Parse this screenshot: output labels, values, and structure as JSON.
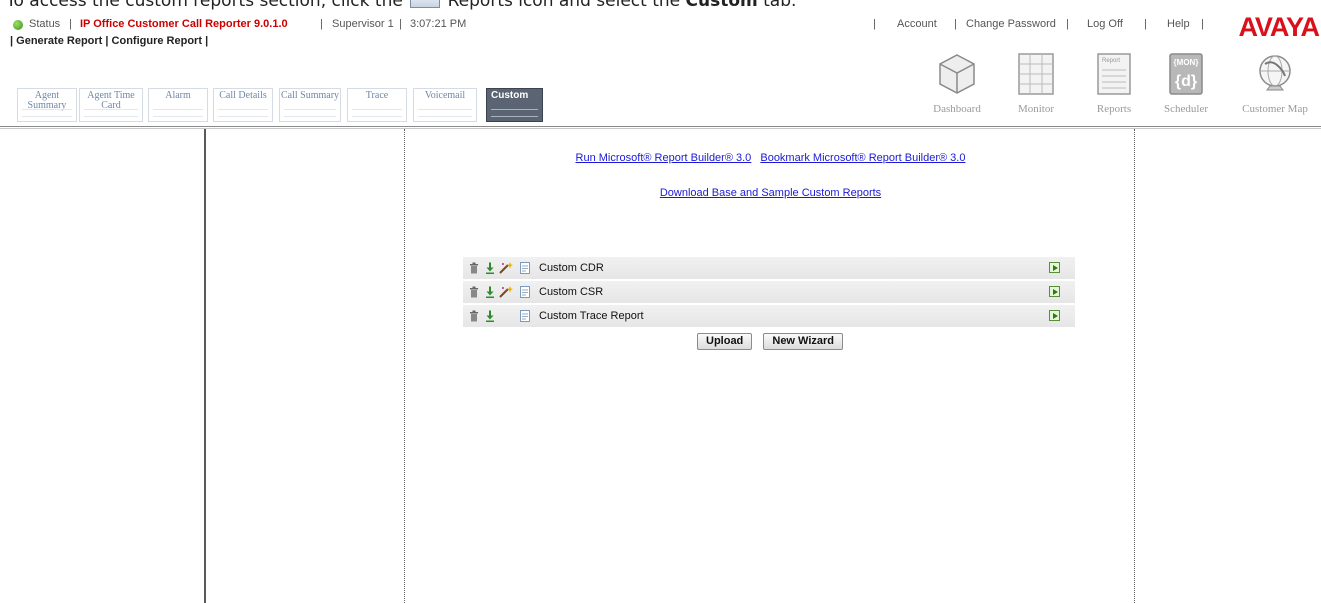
{
  "caption": {
    "before": "To access the custom reports section, click the",
    "middle": "Reports icon and select the",
    "bold": "Custom",
    "after": "tab."
  },
  "status_bar": {
    "status_label": "Status",
    "sep": "|",
    "product": "IP Office Customer Call Reporter 9.0.1.0",
    "user": "Supervisor 1",
    "time": "3:07:21 PM",
    "links": [
      "Account",
      "Change Password",
      "Log Off",
      "Help"
    ],
    "logo": "AVAYA"
  },
  "sub_nav": {
    "generate": "Generate Report",
    "configure": "Configure Report"
  },
  "report_tabs": [
    {
      "label": "Agent Summary"
    },
    {
      "label": "Agent Time Card"
    },
    {
      "label": "Alarm"
    },
    {
      "label": "Call Details"
    },
    {
      "label": "Call Summary"
    },
    {
      "label": "Trace"
    },
    {
      "label": "Voicemail"
    },
    {
      "label": "Custom"
    }
  ],
  "top_icons": [
    {
      "label": "Dashboard",
      "icon": "dashboard-icon"
    },
    {
      "label": "Monitor",
      "icon": "monitor-icon"
    },
    {
      "label": "Reports",
      "icon": "reports-icon",
      "badge": "Report"
    },
    {
      "label": "Scheduler",
      "icon": "scheduler-icon",
      "badge": "{MON}"
    },
    {
      "label": "Customer Map",
      "icon": "globe-icon"
    }
  ],
  "content": {
    "run_builder": "Run Microsoft® Report Builder® 3.0",
    "bookmark_builder": "Bookmark Microsoft® Report Builder® 3.0",
    "download": "Download Base and Sample Custom Reports"
  },
  "reports": [
    {
      "name": "Custom CDR",
      "has_wizard": true
    },
    {
      "name": "Custom CSR",
      "has_wizard": true
    },
    {
      "name": "Custom Trace Report",
      "has_wizard": false
    }
  ],
  "buttons": {
    "upload": "Upload",
    "new_wizard": "New Wizard"
  },
  "colors": {
    "brand_red": "#d8111b",
    "product_red": "#cc0000",
    "link_blue": "#1a1ad6",
    "status_green": "#3b8f12"
  }
}
